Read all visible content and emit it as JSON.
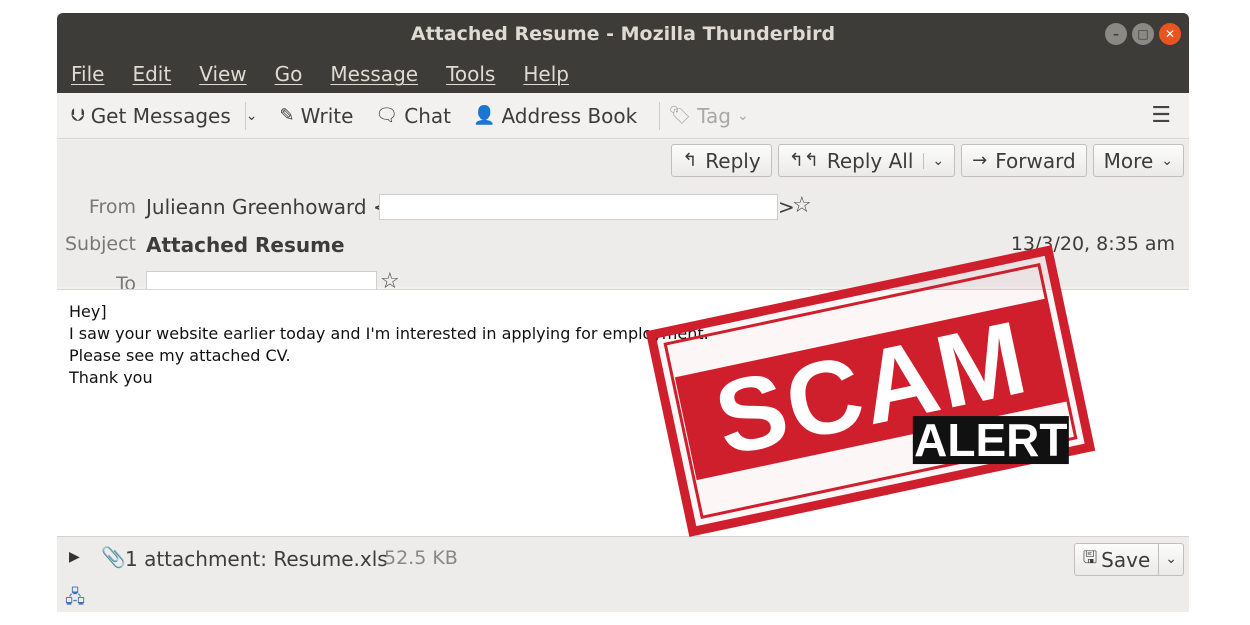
{
  "window": {
    "title": "Attached Resume - Mozilla Thunderbird"
  },
  "menu": {
    "items": [
      "File",
      "Edit",
      "View",
      "Go",
      "Message",
      "Tools",
      "Help"
    ]
  },
  "toolbar": {
    "get_messages": "Get Messages",
    "write": "Write",
    "chat": "Chat",
    "address_book": "Address Book",
    "tag": "Tag"
  },
  "header": {
    "buttons": {
      "reply": "Reply",
      "reply_all": "Reply All",
      "forward": "Forward",
      "more": "More"
    },
    "from_label": "From",
    "from_name": "Julieann Greenhoward <",
    "from_end": ">",
    "subject_label": "Subject",
    "subject": "Attached Resume",
    "date": "13/3/20, 8:35 am",
    "to_label": "To"
  },
  "body": {
    "lines": [
      "Hey]",
      "I saw your website earlier today and I'm interested in applying for employment.",
      "Please see my attached CV.",
      "Thank you"
    ]
  },
  "stamp": {
    "word1": "SCAM",
    "word2": "ALERT"
  },
  "attachment": {
    "summary": "1 attachment: Resume.xls",
    "size": "52.5 KB",
    "save_label": "Save"
  },
  "colors": {
    "titlebar": "#3d3c38",
    "close_button": "#e95420",
    "stamp_red": "#cf1f2d"
  }
}
